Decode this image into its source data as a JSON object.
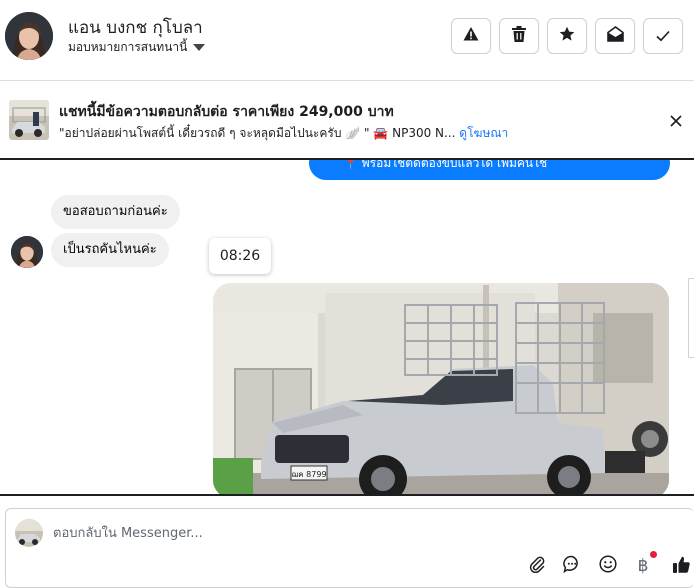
{
  "contact": {
    "name": "แอน บงกช กุโบลา",
    "assign_label": "มอบหมายการสนทนานี้"
  },
  "header_actions": [
    {
      "name": "report-icon"
    },
    {
      "name": "trash-icon"
    },
    {
      "name": "star-icon"
    },
    {
      "name": "mark-unread-icon"
    },
    {
      "name": "checkmark-icon"
    }
  ],
  "ad_banner": {
    "title": "แชทนี้มีข้อความตอบกลับต่อ ราคาเพียง 249,000 บาท",
    "snippet": "\"อย่าปล่อยผ่านโพสต์นี้ เดี๋ยวรถดี ๆ จะหลุดมือไปนะครับ 🪽 \" 🚘 NP300 N...",
    "link_label": "ดูโฆษณา"
  },
  "messages": {
    "sent_partial": "📍 พร้อมใช้ติดต่องขับแล้วได้ เพิ่มคันใช้",
    "received_1": "ขอสอบถามก่อนค่ะ",
    "received_2": "เป็นรถคันไหนค่ะ",
    "tooltip_time": "08:26",
    "photo_plate": "ฌค 8799"
  },
  "reply": {
    "placeholder": "ตอบกลับใน Messenger..."
  },
  "reply_icons": [
    "paperclip-icon",
    "saved-reply-icon",
    "emoji-icon",
    "baht-payment-icon",
    "thumbs-up-icon"
  ],
  "colors": {
    "messenger_blue": "#0a7cff",
    "link_blue": "#1877f2",
    "bubble_grey": "#f0f0f0",
    "notification_red": "#e41e3f"
  }
}
